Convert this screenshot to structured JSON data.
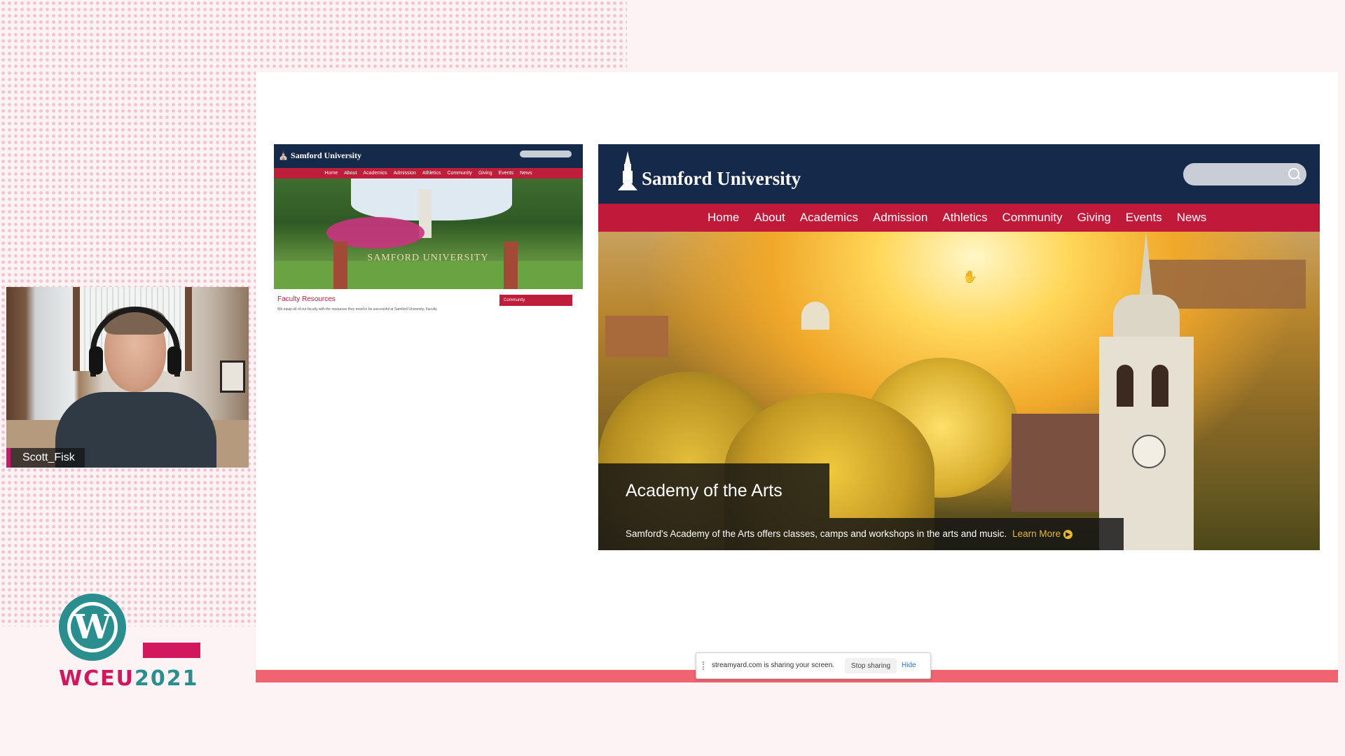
{
  "participant": {
    "name": "Scott_Fisk"
  },
  "event_logo": {
    "text_part1": "WCEU",
    "text_part2": "2021",
    "wp_mark": "W"
  },
  "small_mock": {
    "brand": "Samford University",
    "nav": [
      "Home",
      "About",
      "Academics",
      "Admission",
      "Athletics",
      "Community",
      "Giving",
      "Events",
      "News"
    ],
    "hero_text": "SAMFORD UNIVERSITY",
    "section_title": "Faculty Resources",
    "section_desc": "We equip all of our faculty with the resources they need to be successful at Samford University. Faculty",
    "button_label": "Community"
  },
  "big_mock": {
    "brand": "Samford University",
    "nav": [
      "Home",
      "About",
      "Academics",
      "Admission",
      "Athletics",
      "Community",
      "Giving",
      "Events",
      "News"
    ],
    "caption_title": "Academy of the Arts",
    "caption_body": "Samford's Academy of the Arts offers classes, camps and workshops in the arts and music.",
    "learn_more": "Learn More",
    "learn_more_icon": "▶"
  },
  "share_bar": {
    "message": "streamyard.com is sharing your screen.",
    "stop_label": "Stop sharing",
    "hide_label": "Hide"
  },
  "colors": {
    "navy": "#152a4a",
    "crimson": "#c1193a",
    "wp_teal": "#2a8e8e",
    "wceu_pink": "#d1185e",
    "accent_gold": "#e8b92f"
  }
}
